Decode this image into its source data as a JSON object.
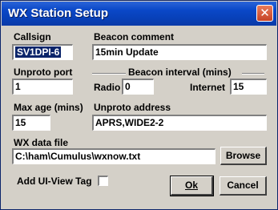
{
  "window": {
    "title": "WX Station Setup",
    "close_icon": "✕"
  },
  "callsign": {
    "label": "Callsign",
    "value": "SV1DPI-6"
  },
  "beacon_comment": {
    "label": "Beacon comment",
    "value": "15min Update"
  },
  "unproto_port": {
    "label": "Unproto port",
    "value": "1"
  },
  "beacon_interval": {
    "label": "Beacon interval (mins)",
    "radio_label": "Radio",
    "radio_value": "0",
    "internet_label": "Internet",
    "internet_value": "15"
  },
  "max_age": {
    "label": "Max age (mins)",
    "value": "15"
  },
  "unproto_address": {
    "label": "Unproto address",
    "value": "APRS,WIDE2-2"
  },
  "wx_data_file": {
    "label": "WX data file",
    "value": "C:\\ham\\Cumulus\\wxnow.txt"
  },
  "browse_button": {
    "label": "Browse"
  },
  "ui_view_tag": {
    "label": "Add UI-View Tag",
    "checked": false
  },
  "ok_button": {
    "label": "Ok"
  },
  "cancel_button": {
    "label": "Cancel"
  }
}
